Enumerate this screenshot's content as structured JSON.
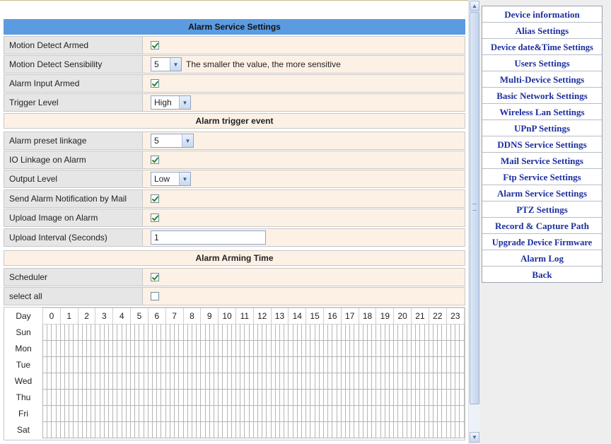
{
  "settings": {
    "title": "Alarm Service Settings",
    "motion_detect_armed": {
      "label": "Motion Detect Armed",
      "checked": true
    },
    "motion_detect_sensibility": {
      "label": "Motion Detect Sensibility",
      "value": "5",
      "hint": "The smaller the value, the more sensitive"
    },
    "alarm_input_armed": {
      "label": "Alarm Input Armed",
      "checked": true
    },
    "trigger_level": {
      "label": "Trigger Level",
      "value": "High"
    },
    "trigger_section": "Alarm trigger event",
    "alarm_preset_linkage": {
      "label": "Alarm preset linkage",
      "value": "5"
    },
    "io_linkage": {
      "label": "IO Linkage on Alarm",
      "checked": true
    },
    "output_level": {
      "label": "Output Level",
      "value": "Low"
    },
    "send_mail": {
      "label": "Send Alarm Notification by Mail",
      "checked": true
    },
    "upload_image": {
      "label": "Upload Image on Alarm",
      "checked": true
    },
    "upload_interval": {
      "label": "Upload Interval (Seconds)",
      "value": "1"
    },
    "arming_section": "Alarm Arming Time",
    "scheduler": {
      "label": "Scheduler",
      "checked": true
    },
    "select_all": {
      "label": "select all",
      "checked": false
    }
  },
  "schedule": {
    "day_header": "Day",
    "hours": [
      "0",
      "1",
      "2",
      "3",
      "4",
      "5",
      "6",
      "7",
      "8",
      "9",
      "10",
      "11",
      "12",
      "13",
      "14",
      "15",
      "16",
      "17",
      "18",
      "19",
      "20",
      "21",
      "22",
      "23"
    ],
    "days": [
      "Sun",
      "Mon",
      "Tue",
      "Wed",
      "Thu",
      "Fri",
      "Sat"
    ]
  },
  "menu": {
    "items": [
      "Device information",
      "Alias Settings",
      "Device date&Time Settings",
      "Users Settings",
      "Multi-Device Settings",
      "Basic Network Settings",
      "Wireless Lan Settings",
      "UPnP Settings",
      "DDNS Service Settings",
      "Mail Service Settings",
      "Ftp Service Settings",
      "Alarm Service Settings",
      "PTZ Settings",
      "Record & Capture Path",
      "Upgrade Device Firmware",
      "Alarm Log",
      "Back"
    ]
  }
}
